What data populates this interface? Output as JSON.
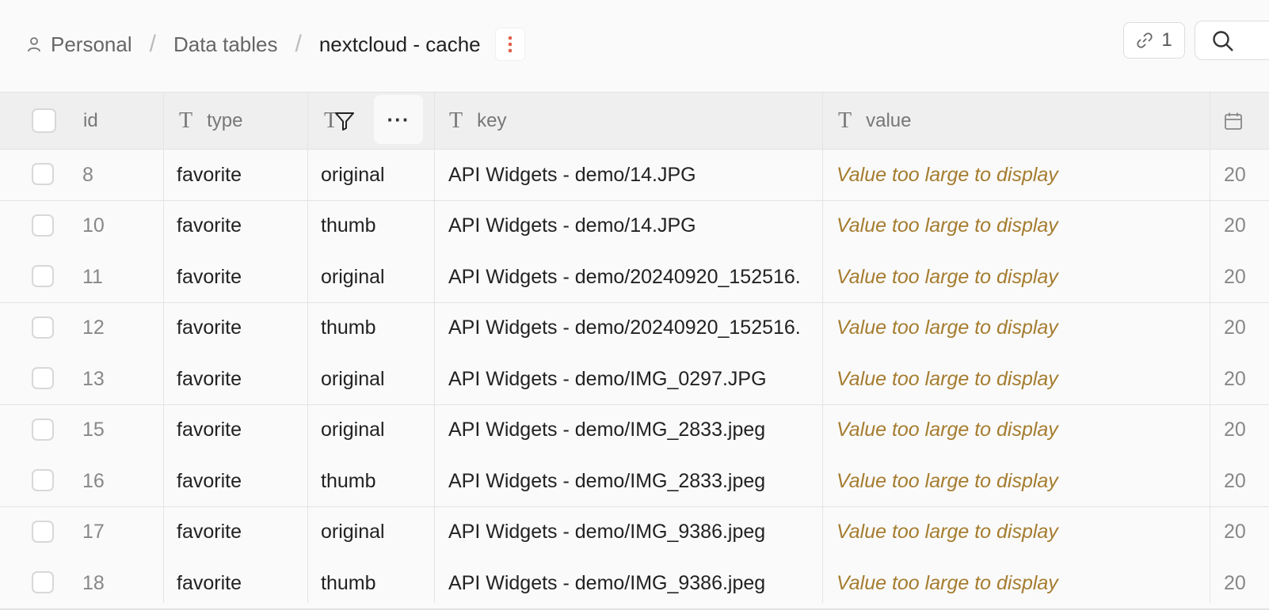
{
  "breadcrumb": {
    "personal": "Personal",
    "section": "Data tables",
    "current": "nextcloud - cache"
  },
  "toolbar": {
    "share_count": "1"
  },
  "columns": {
    "id": "id",
    "type": "type",
    "key": "key",
    "value": "value",
    "more": "···"
  },
  "rows": [
    {
      "id": "8",
      "type": "favorite",
      "sub": "original",
      "key": "API Widgets - demo/14.JPG",
      "value": "Value too large to display",
      "date": "20"
    },
    {
      "id": "10",
      "type": "favorite",
      "sub": "thumb",
      "key": "API Widgets - demo/14.JPG",
      "value": "Value too large to display",
      "date": "20"
    },
    {
      "id": "11",
      "type": "favorite",
      "sub": "original",
      "key": "API Widgets - demo/20240920_152516.",
      "value": "Value too large to display",
      "date": "20"
    },
    {
      "id": "12",
      "type": "favorite",
      "sub": "thumb",
      "key": "API Widgets - demo/20240920_152516.",
      "value": "Value too large to display",
      "date": "20"
    },
    {
      "id": "13",
      "type": "favorite",
      "sub": "original",
      "key": "API Widgets - demo/IMG_0297.JPG",
      "value": "Value too large to display",
      "date": "20"
    },
    {
      "id": "15",
      "type": "favorite",
      "sub": "original",
      "key": "API Widgets - demo/IMG_2833.jpeg",
      "value": "Value too large to display",
      "date": "20"
    },
    {
      "id": "16",
      "type": "favorite",
      "sub": "thumb",
      "key": "API Widgets - demo/IMG_2833.jpeg",
      "value": "Value too large to display",
      "date": "20"
    },
    {
      "id": "17",
      "type": "favorite",
      "sub": "original",
      "key": "API Widgets - demo/IMG_9386.jpeg",
      "value": "Value too large to display",
      "date": "20"
    },
    {
      "id": "18",
      "type": "favorite",
      "sub": "thumb",
      "key": "API Widgets - demo/IMG_9386.jpeg",
      "value": "Value too large to display",
      "date": "20"
    }
  ],
  "colors": {
    "accent_kebab": "#e0604a",
    "value_text": "#a57c2f"
  },
  "icons": [
    "person-icon",
    "kebab-menu-icon",
    "link-icon",
    "search-icon",
    "text-type-icon",
    "filter-icon",
    "calendar-icon"
  ]
}
